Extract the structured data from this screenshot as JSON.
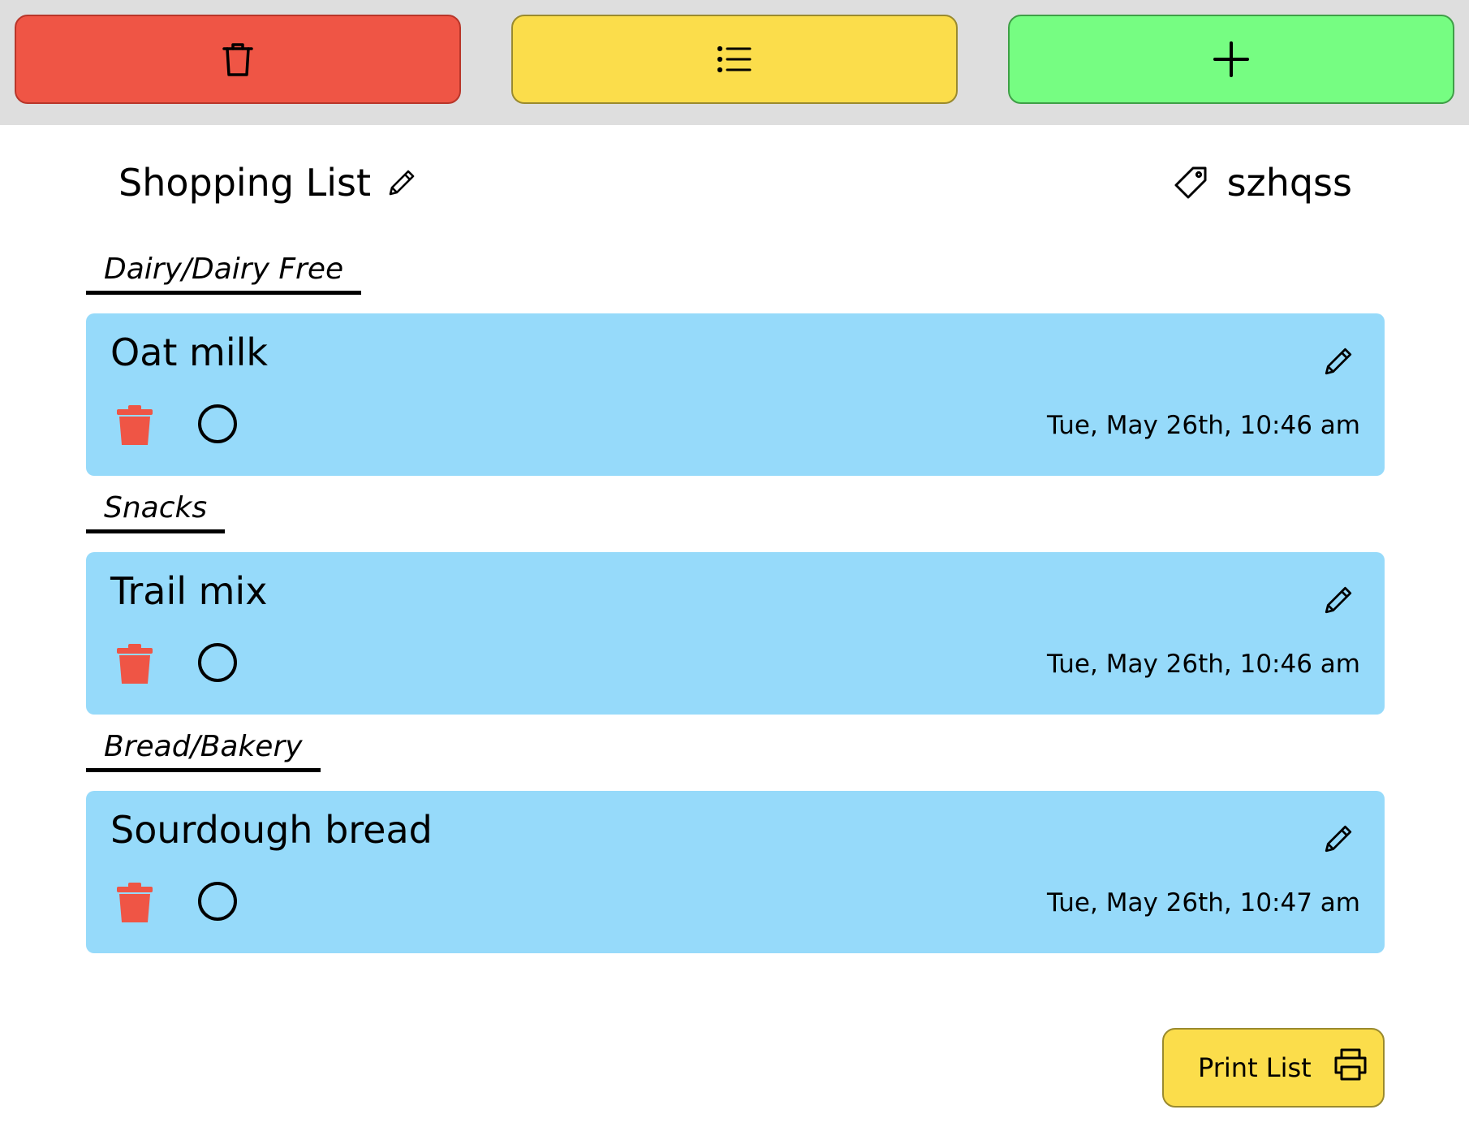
{
  "toolbar": {
    "buttons": [
      {
        "icon": "trash-icon",
        "color": "#ef5545"
      },
      {
        "icon": "list-icon",
        "color": "#fbdd4b"
      },
      {
        "icon": "plus-icon",
        "color": "#76fd82"
      }
    ]
  },
  "header": {
    "title": "Shopping List",
    "user": "szhqss"
  },
  "categories": [
    {
      "label": "Dairy/Dairy Free",
      "items": [
        {
          "name": "Oat milk",
          "date": "Tue, May 26th, 10:46 am"
        }
      ]
    },
    {
      "label": "Snacks",
      "items": [
        {
          "name": "Trail mix",
          "date": "Tue, May 26th, 10:46 am"
        }
      ]
    },
    {
      "label": "Bread/Bakery",
      "items": [
        {
          "name": "Sourdough bread",
          "date": "Tue, May 26th, 10:47 am"
        }
      ]
    }
  ],
  "colors": {
    "item_background": "#96dafa",
    "delete_red": "#ef5545",
    "toolbar_background": "#dedede"
  },
  "print_button": {
    "label": "Print List"
  }
}
